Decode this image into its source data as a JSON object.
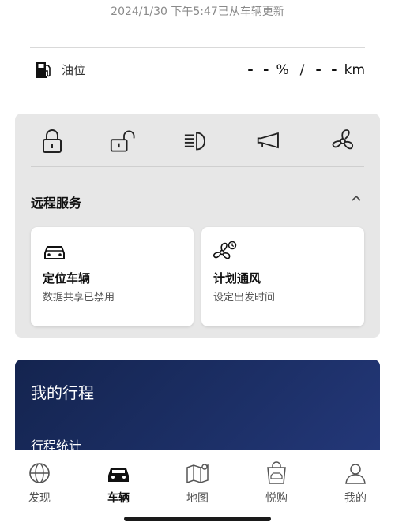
{
  "header": {
    "update_text": "2024/1/30 下午5:47已从车辆更新"
  },
  "fuel": {
    "label": "油位",
    "percent_value": "- -",
    "percent_unit": "%",
    "separator": "/",
    "range_value": "- -",
    "range_unit": "km"
  },
  "quick_controls": [
    "lock-icon",
    "unlock-icon",
    "headlight-icon",
    "horn-icon",
    "fan-icon"
  ],
  "remote_service": {
    "title": "远程服务",
    "tiles": [
      {
        "icon": "car-icon",
        "title": "定位车辆",
        "subtitle": "数据共享已禁用"
      },
      {
        "icon": "fan-schedule-icon",
        "title": "计划通风",
        "subtitle": "设定出发时间"
      }
    ]
  },
  "trip": {
    "title": "我的行程",
    "stats_label": "行程统计"
  },
  "tabs": [
    {
      "label": "发现",
      "icon": "globe-icon",
      "active": false
    },
    {
      "label": "车辆",
      "icon": "car-icon",
      "active": true
    },
    {
      "label": "地图",
      "icon": "map-icon",
      "active": false
    },
    {
      "label": "悦购",
      "icon": "shopping-bag-icon",
      "active": false
    },
    {
      "label": "我的",
      "icon": "person-icon",
      "active": false
    }
  ],
  "colors": {
    "trip_card": "#1c2f66",
    "control_card": "#e7e7e7"
  }
}
